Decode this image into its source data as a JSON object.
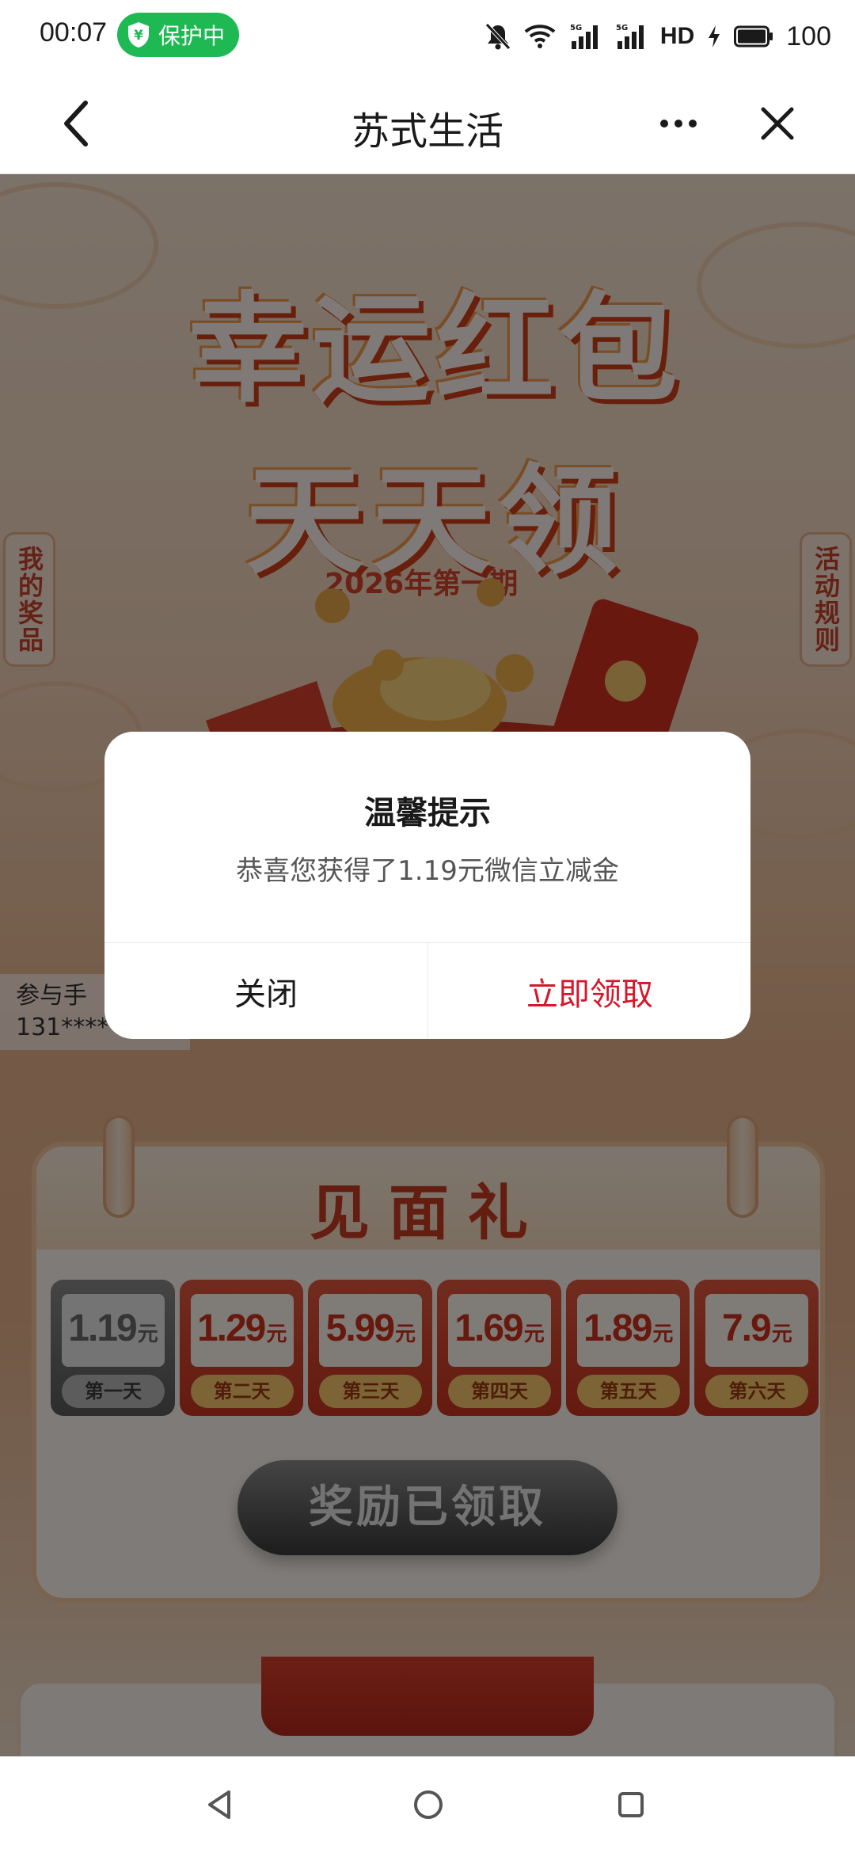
{
  "status_bar": {
    "time": "00:07",
    "protect_label": "保护中",
    "protect_icon": "shield-yen-icon",
    "network_label": "HD",
    "battery_level": "100",
    "icons": [
      "mute-bell-icon",
      "wifi-icon",
      "signal-5g-icon",
      "signal-5g-icon",
      "charging-icon",
      "battery-icon"
    ],
    "accent_color": "#1fb954"
  },
  "title_bar": {
    "title": "苏式生活",
    "back_icon": "chevron-left-icon",
    "more_icon": "more-dots-icon",
    "close_icon": "close-icon"
  },
  "page": {
    "headline_line1": "幸运红包",
    "headline_line2": "天天领",
    "issue": "2026年第一期",
    "side_tab_prizes": "我的奖品",
    "side_tab_rules": "活动规则",
    "participants_line1": "参与手",
    "participants_line2": "131****",
    "gift": {
      "title": "见面礼",
      "days": [
        {
          "amount": "1.19",
          "unit": "元",
          "label": "第一天",
          "state": "used"
        },
        {
          "amount": "1.29",
          "unit": "元",
          "label": "第二天",
          "state": "pending"
        },
        {
          "amount": "5.99",
          "unit": "元",
          "label": "第三天",
          "state": "pending"
        },
        {
          "amount": "1.69",
          "unit": "元",
          "label": "第四天",
          "state": "pending"
        },
        {
          "amount": "1.89",
          "unit": "元",
          "label": "第五天",
          "state": "pending"
        },
        {
          "amount": "7.9",
          "unit": "元",
          "label": "第六天",
          "state": "pending"
        }
      ],
      "claimed_button": "奖励已领取"
    }
  },
  "dialog": {
    "title": "温馨提示",
    "message": "恭喜您获得了1.19元微信立减金",
    "close_label": "关闭",
    "claim_label": "立即领取",
    "claim_color": "#d6162b"
  },
  "nav_bar": {
    "back_icon": "triangle-back-icon",
    "home_icon": "circle-home-icon",
    "recent_icon": "square-recent-icon"
  }
}
